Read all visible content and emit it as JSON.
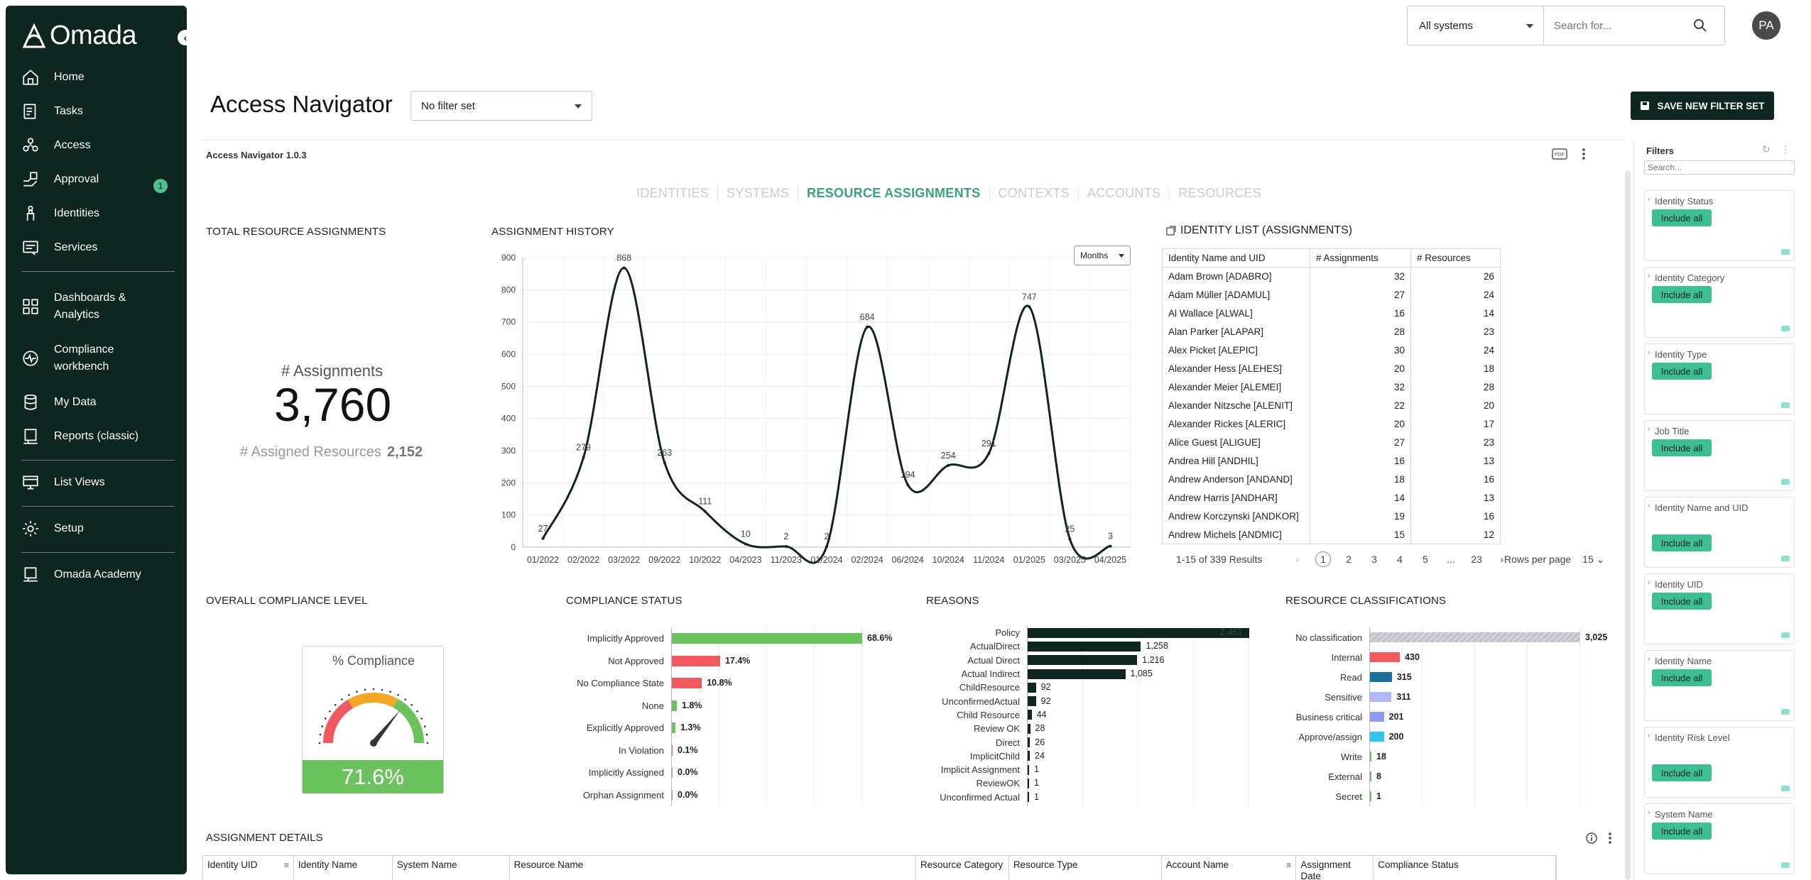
{
  "brand": {
    "name": "Omada",
    "accent": "#3aa17e",
    "dark": "#0e2520"
  },
  "sidebar": {
    "items": [
      {
        "label": "Home",
        "icon": "home-icon"
      },
      {
        "label": "Tasks",
        "icon": "tasks-icon"
      },
      {
        "label": "Access",
        "icon": "access-icon"
      },
      {
        "label": "Approval",
        "icon": "approval-icon",
        "badge": "1"
      },
      {
        "label": "Identities",
        "icon": "identities-icon"
      },
      {
        "label": "Services",
        "icon": "services-icon"
      },
      {
        "label": "Dashboards & Analytics",
        "icon": "dashboards-icon"
      },
      {
        "label": "Compliance workbench",
        "icon": "compliance-icon"
      },
      {
        "label": "My Data",
        "icon": "mydata-icon"
      },
      {
        "label": "Reports (classic)",
        "icon": "reports-icon"
      },
      {
        "label": "List Views",
        "icon": "listviews-icon"
      },
      {
        "label": "Setup",
        "icon": "gear-icon"
      },
      {
        "label": "Omada Academy",
        "icon": "academy-icon"
      }
    ]
  },
  "header": {
    "system_select": "All systems",
    "search_placeholder": "Search for...",
    "avatar": "PA"
  },
  "page": {
    "title": "Access Navigator",
    "filter_select": "No filter set",
    "save_button": "SAVE NEW FILTER SET",
    "app_version": "Access Navigator 1.0.3"
  },
  "tabs": [
    {
      "label": "IDENTITIES",
      "active": false
    },
    {
      "label": "SYSTEMS",
      "active": false
    },
    {
      "label": "RESOURCE ASSIGNMENTS",
      "active": true
    },
    {
      "label": "CONTEXTS",
      "active": false
    },
    {
      "label": "ACCOUNTS",
      "active": false
    },
    {
      "label": "RESOURCES",
      "active": false
    }
  ],
  "sections": {
    "total": "TOTAL RESOURCE ASSIGNMENTS",
    "history": "ASSIGNMENT HISTORY",
    "idlist": "IDENTITY LIST (ASSIGNMENTS)",
    "compliance_level": "OVERALL COMPLIANCE LEVEL",
    "compliance_status": "COMPLIANCE STATUS",
    "reasons": "REASONS",
    "classifications": "RESOURCE CLASSIFICATIONS",
    "details": "ASSIGNMENT DETAILS"
  },
  "kpi": {
    "label": "# Assignments",
    "value": "3,760",
    "sub_label": "# Assigned Resources",
    "sub_value": "2,152"
  },
  "chart_data": [
    {
      "type": "line",
      "title": "ASSIGNMENT HISTORY",
      "granularity": "Months",
      "x": [
        "01/2022",
        "02/2022",
        "03/2022",
        "09/2022",
        "10/2022",
        "04/2023",
        "11/2023",
        "01/2024",
        "02/2024",
        "06/2024",
        "10/2024",
        "11/2024",
        "01/2025",
        "03/2025",
        "04/2025"
      ],
      "values": [
        27,
        279,
        868,
        263,
        111,
        10,
        2,
        2,
        684,
        194,
        254,
        291,
        747,
        25,
        3
      ],
      "ylim": [
        0,
        900
      ],
      "yticks": [
        0,
        100,
        200,
        300,
        400,
        500,
        600,
        700,
        800,
        900
      ],
      "grid": true
    },
    {
      "type": "bar",
      "title": "COMPLIANCE STATUS",
      "categories": [
        "Implicitly Approved",
        "Not Approved",
        "No Compliance State",
        "None",
        "Explicitly Approved",
        "In Violation",
        "Implicitly Assigned",
        "Orphan Assignment"
      ],
      "values": [
        68.6,
        17.4,
        10.8,
        1.8,
        1.3,
        0.1,
        0.0,
        0.0
      ],
      "labels": [
        "68.6%",
        "17.4%",
        "10.8%",
        "1.8%",
        "1.3%",
        "0.1%",
        "0.0%",
        "0.0%"
      ],
      "colors": [
        "#6cc35e",
        "#f05a5f",
        "#f05a5f",
        "#6cc35e",
        "#6cc35e",
        "#f05a5f",
        "#6cc35e",
        "#6cc35e"
      ]
    },
    {
      "type": "bar",
      "title": "REASONS",
      "categories": [
        "Policy",
        "ActualDirect",
        "Actual Direct",
        "Actual Indirect",
        "ChildResource",
        "UnconfirmedActual",
        "Child Resource",
        "Review OK",
        "Direct",
        "ImplicitChild",
        "Implicit Assignment",
        "ReviewOK",
        "Unconfirmed Actual"
      ],
      "values": [
        2461,
        1258,
        1216,
        1085,
        92,
        92,
        44,
        28,
        26,
        24,
        1,
        1,
        1
      ],
      "labels": [
        "2,461",
        "1,258",
        "1,216",
        "1,085",
        "92",
        "92",
        "44",
        "28",
        "26",
        "24",
        "1",
        "1",
        "1"
      ]
    },
    {
      "type": "bar",
      "title": "RESOURCE CLASSIFICATIONS",
      "categories": [
        "No classification",
        "Internal",
        "Read",
        "Sensitive",
        "Business critical",
        "Approve/assign",
        "Write",
        "External",
        "Secret"
      ],
      "values": [
        3025,
        430,
        315,
        311,
        201,
        200,
        18,
        8,
        1
      ],
      "labels": [
        "3,025",
        "430",
        "315",
        "311",
        "201",
        "200",
        "18",
        "8",
        "1"
      ],
      "colors": [
        "#c9c9cf",
        "#f05a5f",
        "#1f6f9c",
        "#b3b9f5",
        "#8e9bf2",
        "#2dc4f0",
        "#6cc35e",
        "#6cc35e",
        "#6cc35e"
      ]
    }
  ],
  "idlist": {
    "columns": [
      "Identity Name and UID",
      "# Assignments",
      "# Resources"
    ],
    "rows": [
      [
        "Adam Brown [ADABRO]",
        "32",
        "26"
      ],
      [
        "Adam Müller [ADAMUL]",
        "27",
        "24"
      ],
      [
        "Al Wallace [ALWAL]",
        "16",
        "14"
      ],
      [
        "Alan Parker [ALAPAR]",
        "28",
        "23"
      ],
      [
        "Alex Picket [ALEPIC]",
        "30",
        "24"
      ],
      [
        "Alexander Hess [ALEHES]",
        "20",
        "18"
      ],
      [
        "Alexander Meier [ALEMEI]",
        "32",
        "28"
      ],
      [
        "Alexander Nitzsche [ALENIT]",
        "22",
        "20"
      ],
      [
        "Alexander Rickes [ALERIC]",
        "20",
        "17"
      ],
      [
        "Alice Guest [ALIGUE]",
        "27",
        "23"
      ],
      [
        "Andrea Hill [ANDHIL]",
        "16",
        "13"
      ],
      [
        "Andrew Anderson [ANDAND]",
        "18",
        "16"
      ],
      [
        "Andrew Harris [ANDHAR]",
        "14",
        "13"
      ],
      [
        "Andrew Korczynski [ANDKOR]",
        "19",
        "16"
      ],
      [
        "Andrew Michels [ANDMIC]",
        "15",
        "12"
      ]
    ],
    "results": "1-15 of 339 Results",
    "pages": [
      "1",
      "2",
      "3",
      "4",
      "5",
      "...",
      "23"
    ],
    "rows_per_page_label": "Rows per page",
    "rows_per_page": "15"
  },
  "gauge": {
    "title": "% Compliance",
    "value": "71.6%",
    "fraction": 0.716
  },
  "filters": {
    "title": "Filters",
    "search_placeholder": "Search...",
    "button_label": "Include all",
    "items": [
      "Identity Status",
      "Identity Category",
      "Identity Type",
      "Job Title",
      "Identity Name and UID",
      "Identity UID",
      "Identity Name",
      "Identity Risk Level",
      "System Name"
    ]
  },
  "details": {
    "columns": [
      "Identity UID",
      "Identity Name",
      "System Name",
      "Resource Name",
      "Resource Category",
      "Resource Type",
      "Account Name",
      "Assignment Date",
      "Compliance Status"
    ]
  }
}
